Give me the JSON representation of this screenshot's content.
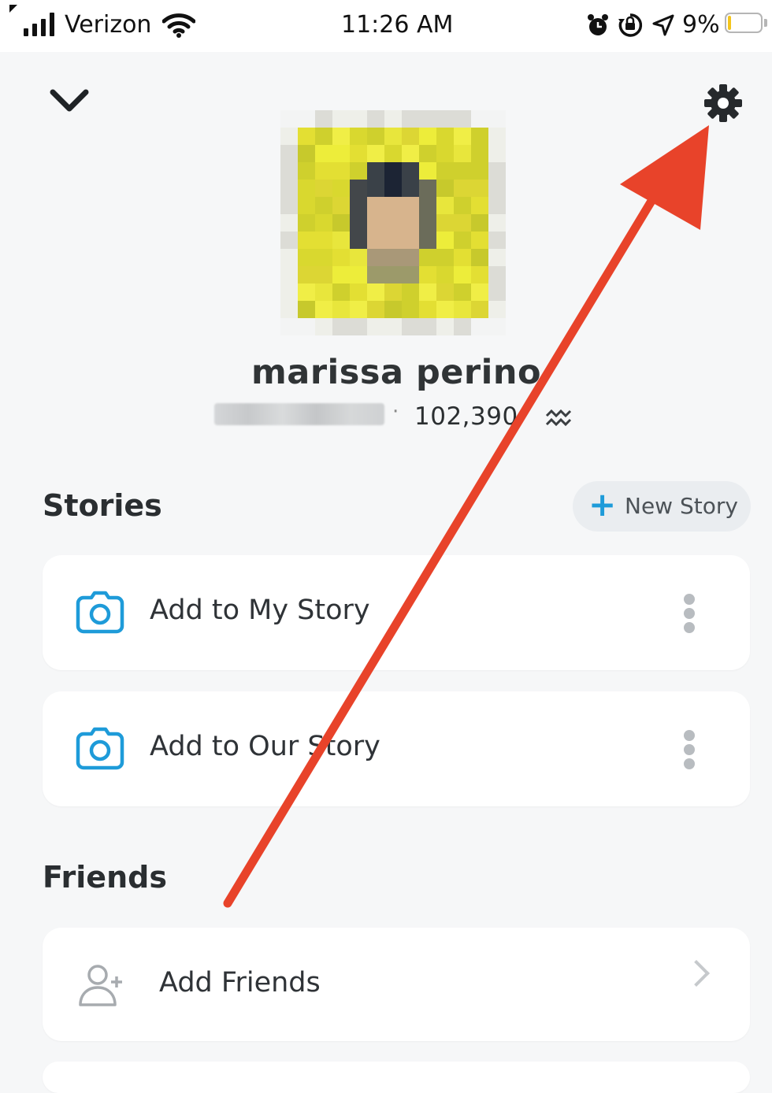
{
  "status_bar": {
    "carrier": "Verizon",
    "time": "11:26 AM",
    "battery_percent": "9%",
    "battery_level": 0.09
  },
  "header": {
    "collapse_icon": "chevron-down-icon",
    "settings_icon": "gear-icon"
  },
  "profile": {
    "display_name": "marissa perino",
    "separator": "·",
    "snap_score": "102,390",
    "zodiac_icon": "aquarius-icon"
  },
  "stories": {
    "title": "Stories",
    "new_story_icon": "plus-icon",
    "new_story_label": "New Story",
    "items": [
      {
        "label": "Add to My Story",
        "icon": "camera-icon",
        "more_icon": "kebab-icon"
      },
      {
        "label": "Add to Our Story",
        "icon": "camera-icon",
        "more_icon": "kebab-icon"
      }
    ]
  },
  "friends": {
    "title": "Friends",
    "items": [
      {
        "label": "Add Friends",
        "icon": "add-friend-icon",
        "nav_icon": "chevron-right-icon"
      }
    ]
  },
  "annotation": {
    "arrow_color": "#e8432a",
    "points_to": "settings gear"
  },
  "colors": {
    "accent_blue": "#1e9bd9",
    "bitmoji_yellow": "#e4e136",
    "background": "#f6f7f8"
  }
}
